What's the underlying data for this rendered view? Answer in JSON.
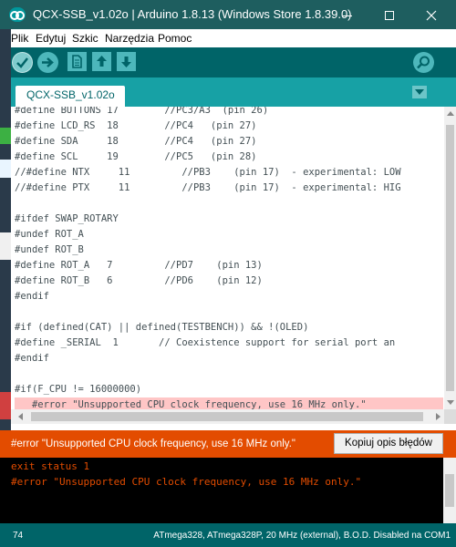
{
  "window": {
    "title": "QCX-SSB_v1.02o | Arduino 1.8.13 (Windows Store 1.8.39.0)"
  },
  "menubar": {
    "items": [
      "Plik",
      "Edytuj",
      "Szkic",
      "Narzędzia",
      "Pomoc"
    ]
  },
  "toolbar": {
    "icons": [
      "verify-icon",
      "upload-icon",
      "new-icon",
      "open-icon",
      "save-icon",
      "serial-monitor-icon"
    ]
  },
  "tabs": [
    {
      "label": "QCX-SSB_v1.02o"
    }
  ],
  "editor": {
    "lines": [
      "#define BUTTONS 17        //PC3/A3  (pin 26)",
      "#define LCD_RS  18        //PC4   (pin 27)",
      "#define SDA     18        //PC4   (pin 27)",
      "#define SCL     19        //PC5   (pin 28)",
      "//#define NTX     11         //PB3    (pin 17)  - experimental: LOW",
      "//#define PTX     11         //PB3    (pin 17)  - experimental: HIG",
      "",
      "#ifdef SWAP_ROTARY",
      "#undef ROT_A",
      "#undef ROT_B",
      "#define ROT_A   7         //PD7    (pin 13)",
      "#define ROT_B   6         //PD6    (pin 12)",
      "#endif",
      "",
      "#if (defined(CAT) || defined(TESTBENCH)) && !(OLED)",
      "#define _SERIAL  1       // Coexistence support for serial port an",
      "#endif",
      "",
      "#if(F_CPU != 16000000)",
      "   #error \"Unsupported CPU clock frequency, use 16 MHz only.\""
    ],
    "highlight_line_index": 19
  },
  "status": {
    "message": "#error \"Unsupported CPU clock frequency, use 16 MHz only.\"",
    "copy_button": "Kopiuj opis błędów"
  },
  "console": {
    "lines": [
      "exit status 1",
      "#error \"Unsupported CPU clock frequency, use 16 MHz only.\""
    ]
  },
  "footer": {
    "line_number": "74",
    "board": "ATmega328, ATmega328P, 20 MHz (external), B.O.D. Disabled na COM1"
  },
  "colors": {
    "teal_dark": "#006468",
    "teal_tabs": "#17a1a5",
    "error_orange": "#e34c00",
    "error_highlight": "#ffc6c6"
  }
}
